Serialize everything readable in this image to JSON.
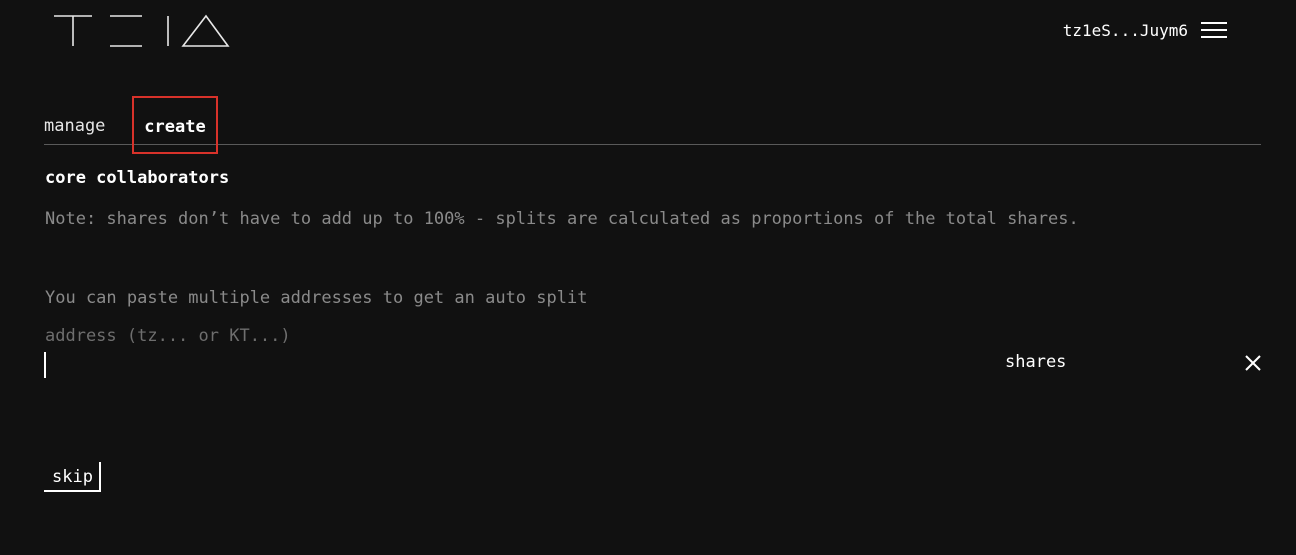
{
  "header": {
    "logo_alt": "TEIA",
    "wallet_address": "tz1eS...Juym6"
  },
  "tabs": [
    {
      "label": "manage",
      "active": false
    },
    {
      "label": "create",
      "active": true
    }
  ],
  "form": {
    "section_title": "core collaborators",
    "note": "Note: shares don’t have to add up to 100% - splits are calculated as proportions of the total shares.",
    "paste_hint": "You can paste multiple addresses to get an auto split",
    "address_placeholder": "address (tz... or KT...)",
    "address_value": "",
    "shares_label": "shares"
  },
  "actions": {
    "skip_label": "skip"
  },
  "colors": {
    "background": "#111111",
    "text": "#ffffff",
    "muted": "#8a8a8a",
    "highlight": "#d8322a"
  },
  "icons": {
    "logo": "teia-logo",
    "menu": "hamburger-menu-icon",
    "remove": "close-icon"
  }
}
